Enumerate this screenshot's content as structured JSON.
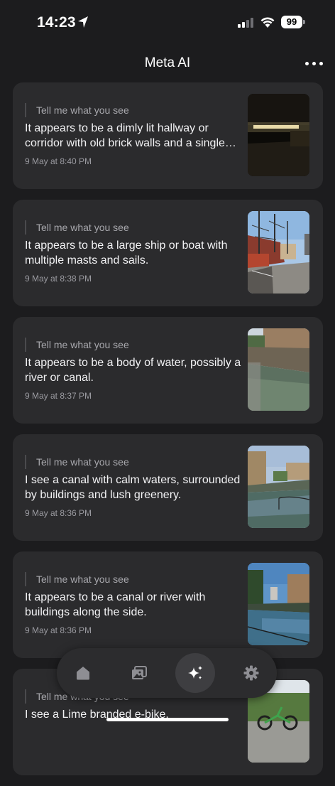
{
  "status_bar": {
    "time": "14:23",
    "battery": "99"
  },
  "nav": {
    "title": "Meta AI"
  },
  "cards": [
    {
      "prompt": "Tell me what you see",
      "reply": "It appears to be a dimly lit hallway or corridor with old brick walls and a single light source.",
      "timestamp": "9 May at 8:40 PM",
      "thumb": "dark-hallway-photo"
    },
    {
      "prompt": "Tell me what you see",
      "reply": "It appears to be a large ship or boat with multiple masts and sails.",
      "timestamp": "9 May at 8:38 PM",
      "thumb": "ship-masts-photo"
    },
    {
      "prompt": "Tell me what you see",
      "reply": "It appears to be a body of water, possibly a river or canal.",
      "timestamp": "9 May at 8:37 PM",
      "thumb": "river-wall-photo"
    },
    {
      "prompt": "Tell me what you see",
      "reply": "I see a canal with calm waters, surrounded by buildings and lush greenery.",
      "timestamp": "9 May at 8:36 PM",
      "thumb": "canal-buildings-photo"
    },
    {
      "prompt": "Tell me what you see",
      "reply": "It appears to be a canal or river with buildings along the side.",
      "timestamp": "9 May at 8:36 PM",
      "thumb": "canal-wide-photo"
    },
    {
      "prompt": "Tell me what you see",
      "reply": "I see a Lime branded e-bike.",
      "timestamp": "",
      "thumb": "e-bike-photo"
    }
  ],
  "tab_bar": {
    "items": [
      {
        "icon": "home-icon",
        "active": false
      },
      {
        "icon": "gallery-icon",
        "active": false
      },
      {
        "icon": "sparkle-icon",
        "active": true
      },
      {
        "icon": "gear-icon",
        "active": false
      }
    ]
  },
  "colors": {
    "background": "#1c1c1e",
    "card": "#2b2b2d",
    "tab_bar": "#2c2c2e"
  }
}
